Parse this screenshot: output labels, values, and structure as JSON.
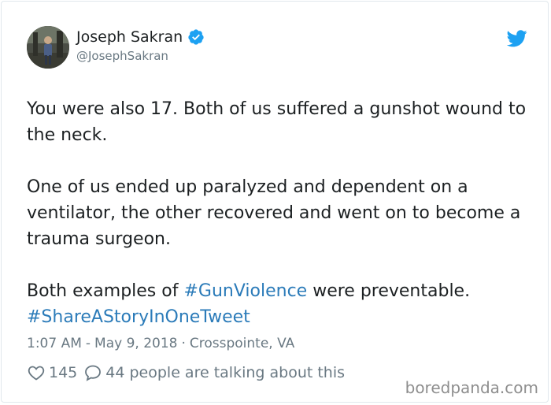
{
  "tweet": {
    "author": {
      "display_name": "Joseph Sakran",
      "handle": "@JosephSakran",
      "verified": true
    },
    "text": {
      "paragraph1": "You were also 17. Both of us suffered a gunshot wound to the neck.",
      "paragraph2": "One of us ended up paralyzed and dependent on a ventilator, the other recovered and went on to become a trauma surgeon.",
      "paragraph3_prefix": "Both examples of ",
      "hashtag1": "#GunViolence",
      "paragraph3_suffix": " were preventable.",
      "hashtag2": "#ShareAStoryInOneTweet"
    },
    "meta": {
      "time": "1:07 AM",
      "separator1": "-",
      "date": "May 9, 2018",
      "separator2": "·",
      "location": "Crosspointe, VA"
    },
    "actions": {
      "likes": "145",
      "replies_text": "44 people are talking about this"
    }
  },
  "watermark": "boredpanda.com",
  "colors": {
    "text": "#1c2022",
    "secondary": "#697882",
    "link": "#2b7bb9",
    "verified": "#1da1f2",
    "twitter_brand": "#1da1f2"
  },
  "icons": {
    "bird": "twitter-bird-icon",
    "verified": "verified-badge-icon",
    "like": "heart-icon",
    "reply": "speech-bubble-icon"
  }
}
